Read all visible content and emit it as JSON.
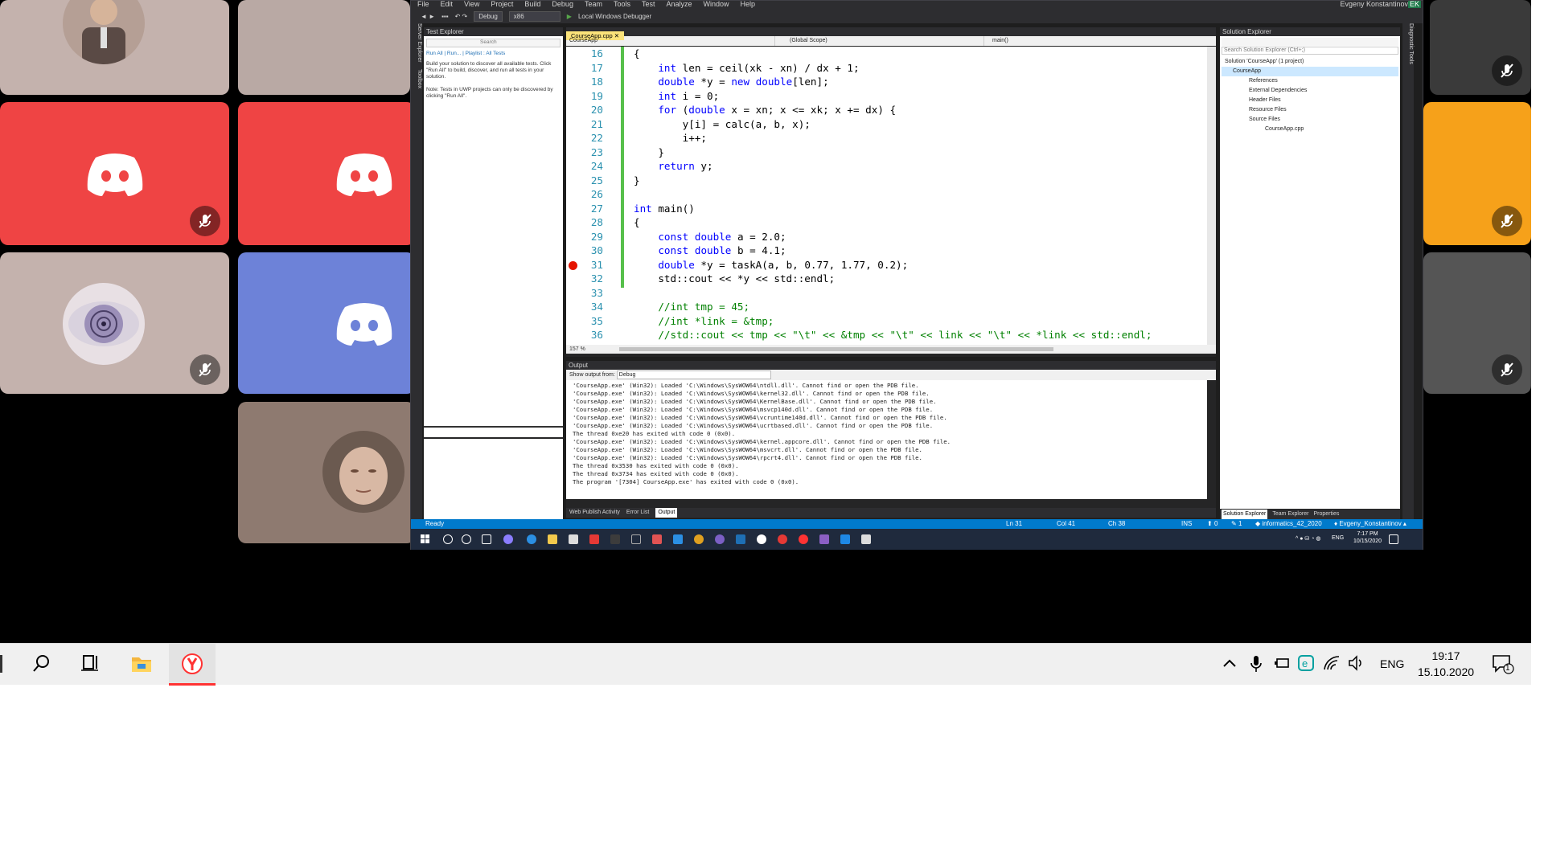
{
  "inner_ide": {
    "menu": [
      "File",
      "Edit",
      "View",
      "Project",
      "Build",
      "Debug",
      "Team",
      "Tools",
      "Test",
      "Analyze",
      "Window",
      "Help"
    ],
    "user_name": "Evgeny Konstantinov",
    "user_initials": "EK",
    "toolbar": {
      "config": "Debug",
      "platform": "x86",
      "debugger": "Local Windows Debugger"
    },
    "test_explorer": {
      "title": "Test Explorer",
      "search_placeholder": "Search",
      "actions": [
        "Run All",
        "Run...",
        "Playlist : All Tests"
      ],
      "info_text": "Build your solution to discover all available tests. Click \"Run All\" to build, discover, and run all tests in your solution.",
      "note_text": "Note: Tests in UWP projects can only be discovered by clicking \"Run All\"."
    },
    "left_strip": [
      "Server Explorer",
      "Toolbox"
    ],
    "right_strip": "Diagnostic Tools",
    "editor": {
      "tab": "CourseApp.cpp",
      "nav": [
        "CourseApp",
        "(Global Scope)",
        "main()"
      ],
      "zoom": "157 %",
      "lines": [
        {
          "n": "16",
          "t": "{"
        },
        {
          "n": "17",
          "t": "    int len = ceil(xk - xn) / dx + 1;"
        },
        {
          "n": "18",
          "t": "    double *y = new double[len];"
        },
        {
          "n": "19",
          "t": "    int i = 0;"
        },
        {
          "n": "20",
          "t": "    for (double x = xn; x <= xk; x += dx) {"
        },
        {
          "n": "21",
          "t": "        y[i] = calc(a, b, x);"
        },
        {
          "n": "22",
          "t": "        i++;"
        },
        {
          "n": "23",
          "t": "    }"
        },
        {
          "n": "24",
          "t": "    return y;"
        },
        {
          "n": "25",
          "t": "}"
        },
        {
          "n": "26",
          "t": ""
        },
        {
          "n": "27",
          "t": "int main()"
        },
        {
          "n": "28",
          "t": "{"
        },
        {
          "n": "29",
          "t": "    const double a = 2.0;"
        },
        {
          "n": "30",
          "t": "    const double b = 4.1;"
        },
        {
          "n": "31",
          "t": "    double *y = taskA(a, b, 0.77, 1.77, 0.2);"
        },
        {
          "n": "32",
          "t": "    std::cout << *y << std::endl;"
        },
        {
          "n": "33",
          "t": ""
        },
        {
          "n": "34",
          "t": "    //int tmp = 45;"
        },
        {
          "n": "35",
          "t": "    //int *link = &tmp;"
        },
        {
          "n": "36",
          "t": "    //std::cout << tmp << \"\\t\" << &tmp << \"\\t\" << link << \"\\t\" << *link << std::endl;"
        }
      ]
    },
    "output": {
      "title": "Output",
      "show_label": "Show output from:",
      "source": "Debug",
      "lines": [
        "'CourseApp.exe' (Win32): Loaded 'C:\\Windows\\SysWOW64\\ntdll.dll'. Cannot find or open the PDB file.",
        "'CourseApp.exe' (Win32): Loaded 'C:\\Windows\\SysWOW64\\kernel32.dll'. Cannot find or open the PDB file.",
        "'CourseApp.exe' (Win32): Loaded 'C:\\Windows\\SysWOW64\\KernelBase.dll'. Cannot find or open the PDB file.",
        "'CourseApp.exe' (Win32): Loaded 'C:\\Windows\\SysWOW64\\msvcp140d.dll'. Cannot find or open the PDB file.",
        "'CourseApp.exe' (Win32): Loaded 'C:\\Windows\\SysWOW64\\vcruntime140d.dll'. Cannot find or open the PDB file.",
        "'CourseApp.exe' (Win32): Loaded 'C:\\Windows\\SysWOW64\\ucrtbased.dll'. Cannot find or open the PDB file.",
        "The thread 0xe20 has exited with code 0 (0x0).",
        "'CourseApp.exe' (Win32): Loaded 'C:\\Windows\\SysWOW64\\kernel.appcore.dll'. Cannot find or open the PDB file.",
        "'CourseApp.exe' (Win32): Loaded 'C:\\Windows\\SysWOW64\\msvcrt.dll'. Cannot find or open the PDB file.",
        "'CourseApp.exe' (Win32): Loaded 'C:\\Windows\\SysWOW64\\rpcrt4.dll'. Cannot find or open the PDB file.",
        "The thread 0x3530 has exited with code 0 (0x0).",
        "The thread 0x3734 has exited with code 0 (0x0).",
        "The program '[7304] CourseApp.exe' has exited with code 0 (0x0)."
      ],
      "tabs": [
        "Web Publish Activity",
        "Error List",
        "Output"
      ]
    },
    "solution_explorer": {
      "title": "Solution Explorer",
      "search_placeholder": "Search Solution Explorer (Ctrl+;)",
      "items": [
        "Solution 'CourseApp' (1 project)",
        "CourseApp",
        "References",
        "External Dependencies",
        "Header Files",
        "Resource Files",
        "Source Files",
        "CourseApp.cpp"
      ],
      "tabs": [
        "Solution Explorer",
        "Team Explorer",
        "Properties"
      ]
    },
    "status": {
      "ready": "Ready",
      "ln": "Ln 31",
      "col": "Col 41",
      "ch": "Ch 38",
      "mode": "INS",
      "up": "0",
      "pencil": "1",
      "repo": "informatics_42_2020",
      "user": "Evgeny_Konstantinov"
    },
    "inner_clock": {
      "time": "7:17 PM",
      "date": "10/15/2020"
    },
    "inner_lang": "ENG"
  },
  "taskbar": {
    "lang": "ENG",
    "time": "19:17",
    "date": "15.10.2020",
    "notifications": "1"
  },
  "colors": {
    "discord_red": "#ef4444",
    "discord_blurple": "#6d82d8",
    "discord_orange": "#f6a11a",
    "vs_blue": "#007acc",
    "yandex_red": "#ff3333"
  }
}
